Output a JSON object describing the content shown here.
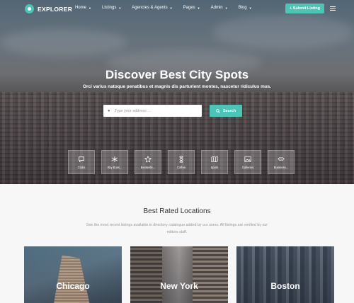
{
  "brand": {
    "name": "EXPLORER",
    "accent_color": "#4bc5b5"
  },
  "nav": {
    "items": [
      {
        "label": "Home"
      },
      {
        "label": "Listings"
      },
      {
        "label": "Agencies & Agents"
      },
      {
        "label": "Pages"
      },
      {
        "label": "Admin"
      },
      {
        "label": "Blog"
      }
    ],
    "submit_label": "+ Submit Listing"
  },
  "hero": {
    "title": "Discover Best City Spots",
    "subtitle": "Orci varius natoque penatibus et magnis dis parturient montes, nascetur ridiculus mus.",
    "search_placeholder": "Type your address ...",
    "search_button": "Search"
  },
  "categories": [
    {
      "label": "Clubs",
      "icon": "chat-bubble-icon"
    },
    {
      "label": "Sky Boss...",
      "icon": "snowflake-icon"
    },
    {
      "label": "Bestselle...",
      "icon": "star-icon"
    },
    {
      "label": "Coffee",
      "icon": "hourglass-icon"
    },
    {
      "label": "Spots",
      "icon": "map-icon"
    },
    {
      "label": "Galleries",
      "icon": "image-icon"
    },
    {
      "label": "Business...",
      "icon": "handshake-icon"
    }
  ],
  "section": {
    "title": "Best Rated Locations",
    "description": "See the most recent listings available in directory catalogue added by our users. All listings are verified by our editors staff."
  },
  "cities": [
    {
      "name": "Chicago"
    },
    {
      "name": "New York"
    },
    {
      "name": "Boston"
    }
  ]
}
